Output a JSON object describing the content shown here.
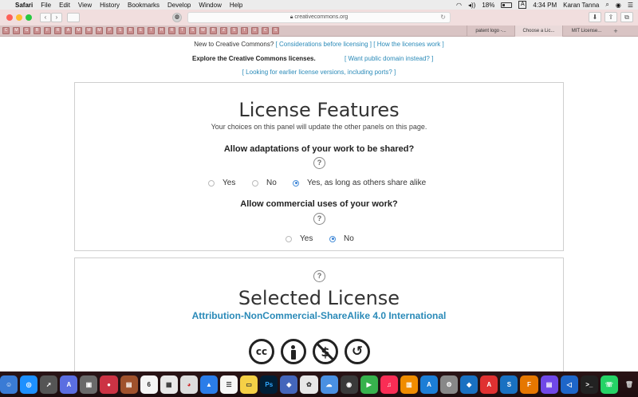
{
  "menubar": {
    "app": "Safari",
    "items": [
      "File",
      "Edit",
      "View",
      "History",
      "Bookmarks",
      "Develop",
      "Window",
      "Help"
    ],
    "battery": "18%",
    "time": "4:34 PM",
    "user": "Karan Tanna"
  },
  "toolbar": {
    "url": "creativecommons.org"
  },
  "tabs": [
    {
      "label": "patent logo -..."
    },
    {
      "label": "Choose a Lic..."
    },
    {
      "label": "MIT License..."
    }
  ],
  "favorites": [
    "C",
    "M",
    "G",
    "B",
    "F",
    "R",
    "A",
    "M",
    "M",
    "M",
    "P",
    "S",
    "B",
    "E",
    "T",
    "H",
    "R",
    "T",
    "S",
    "W",
    "B",
    "Z",
    "S",
    "T",
    "U",
    "C",
    "S"
  ],
  "page": {
    "intro_text": "New to Creative Commons?",
    "link_considerations": "[ Considerations before licensing ]",
    "link_how": "[ How the licenses work ]",
    "explore_label": "Explore the Creative Commons licenses.",
    "link_public_domain": "[ Want public domain instead? ]",
    "link_earlier": "[ Looking for earlier license versions, including ports? ]"
  },
  "features": {
    "title": "License Features",
    "subtitle": "Your choices on this panel will update the other panels on this page.",
    "q1": {
      "label": "Allow adaptations of your work to be shared?",
      "options": [
        "Yes",
        "No",
        "Yes, as long as others share alike"
      ],
      "selected": "Yes, as long as others share alike"
    },
    "q2": {
      "label": "Allow commercial uses of your work?",
      "options": [
        "Yes",
        "No"
      ],
      "selected": "No"
    }
  },
  "selected": {
    "title": "Selected License",
    "license_name": "Attribution-NonCommercial-ShareAlike 4.0 International",
    "icons": [
      "cc-icon",
      "by-icon",
      "nc-icon",
      "sa-icon"
    ]
  },
  "dock": {
    "calendar_day": "6"
  }
}
